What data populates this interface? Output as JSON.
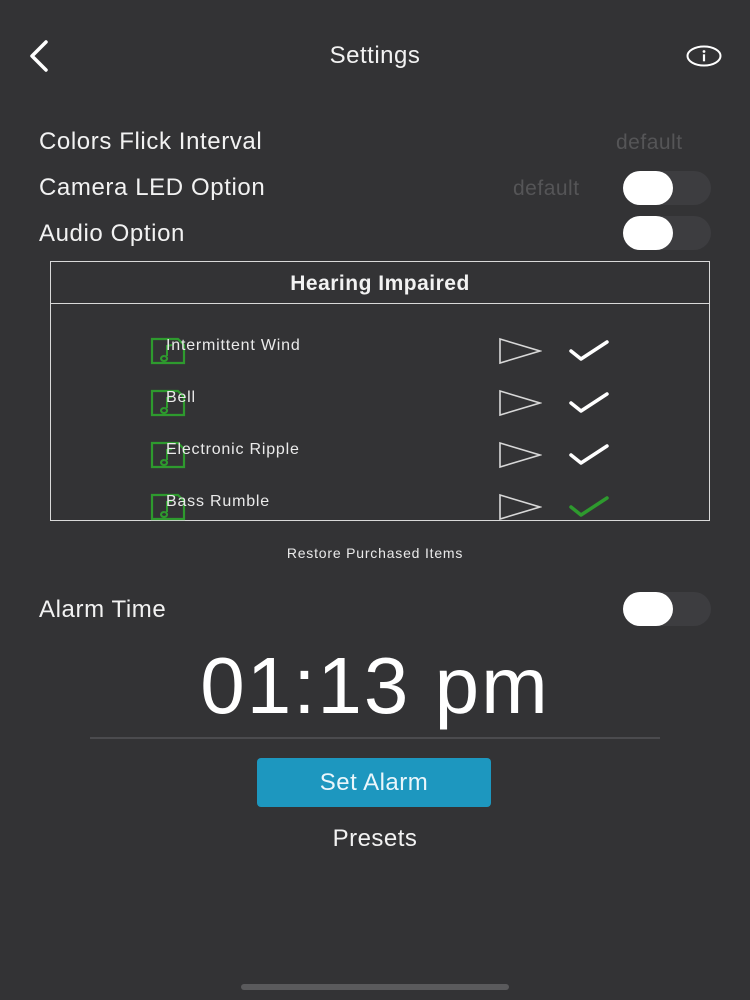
{
  "header": {
    "title": "Settings",
    "back_icon": "chevron-left-icon",
    "info_icon": "info-icon"
  },
  "settings": {
    "colors_flick": {
      "label": "Colors Flick Interval",
      "value": "default"
    },
    "camera_led": {
      "label": "Camera LED Option",
      "value": "default",
      "enabled": false
    },
    "audio": {
      "label": "Audio Option",
      "enabled": false
    }
  },
  "sound_panel": {
    "title": "Hearing Impaired",
    "items": [
      {
        "name": "Intermittent Wind",
        "selected": false
      },
      {
        "name": "Bell",
        "selected": false
      },
      {
        "name": "Electronic Ripple",
        "selected": false
      },
      {
        "name": "Bass Rumble",
        "selected": true
      }
    ]
  },
  "restore_label": "Restore Purchased Items",
  "alarm": {
    "label": "Alarm Time",
    "enabled": false,
    "time": "01:13 pm",
    "set_button": "Set Alarm",
    "presets_label": "Presets"
  },
  "colors": {
    "background": "#333335",
    "accent": "#1d97bf",
    "sound_icon": "#2e9a2e",
    "check_default": "#ffffff",
    "check_selected": "#2e9a2e",
    "muted_text": "#555557"
  }
}
